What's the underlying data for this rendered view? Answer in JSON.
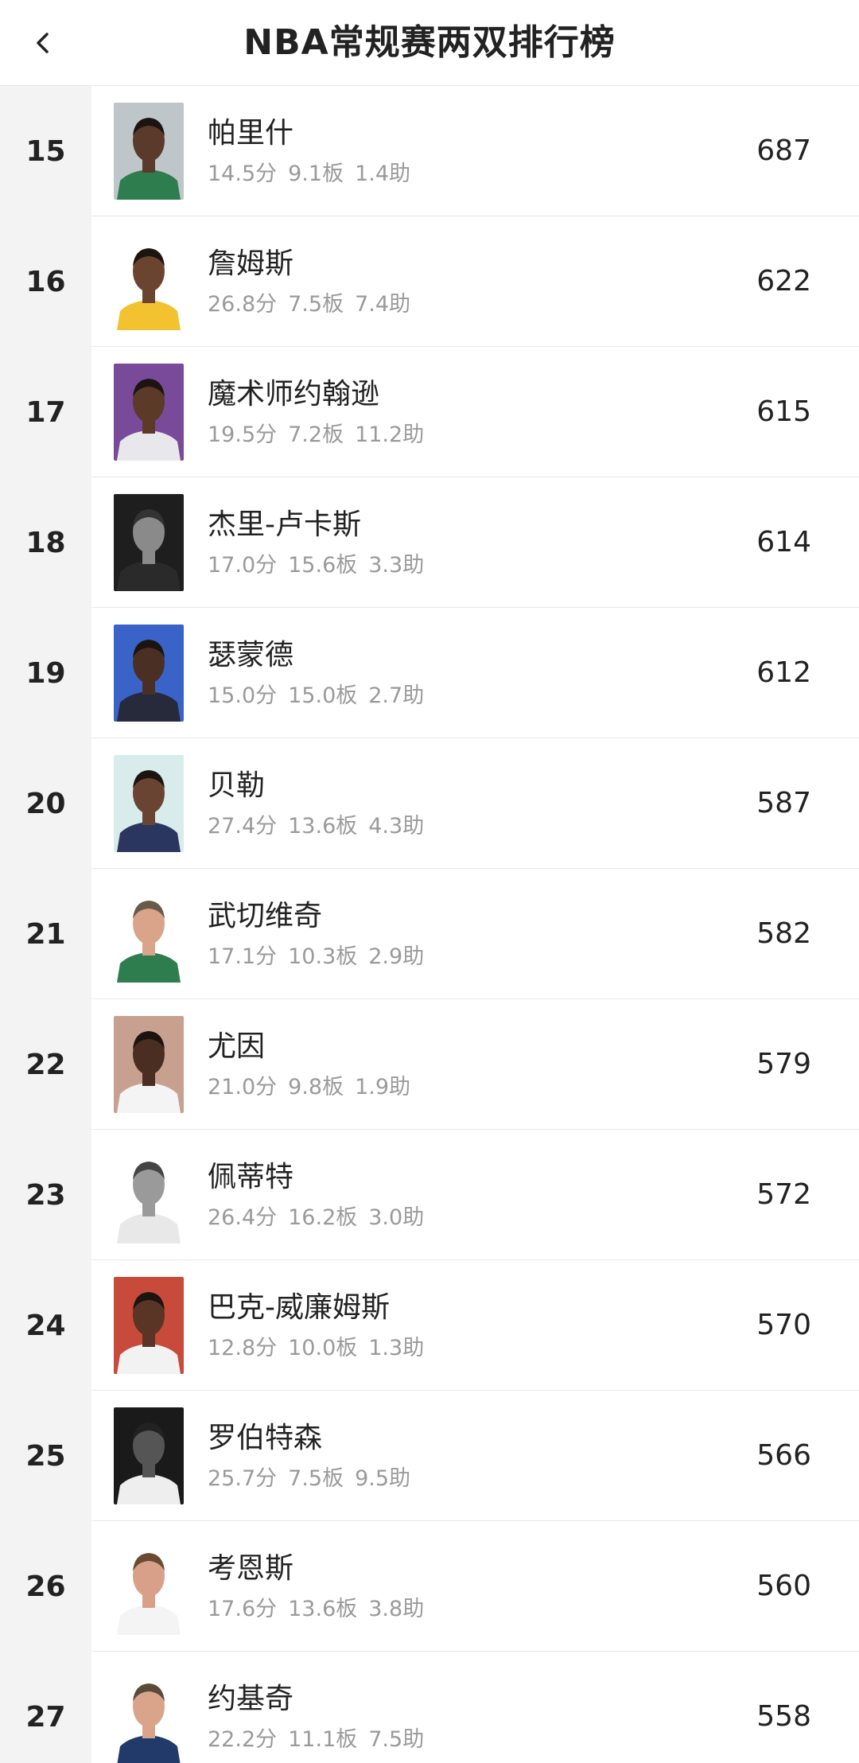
{
  "header": {
    "title": "NBA常规赛两双排行榜",
    "back_icon": "chevron-left-icon"
  },
  "rows": [
    {
      "rank": "15",
      "name": "帕里什",
      "pts": "14.5分",
      "reb": "9.1板",
      "ast": "1.4助",
      "value": "687",
      "skin": "#5a3a2a",
      "jersey": "#2e7d4f",
      "bg": "#bfc6c9",
      "hair": "#1c1410"
    },
    {
      "rank": "16",
      "name": "詹姆斯",
      "pts": "26.8分",
      "reb": "7.5板",
      "ast": "7.4助",
      "value": "622",
      "skin": "#6b4430",
      "jersey": "#f2c230",
      "bg": "#ffffff",
      "hair": "#1c1410"
    },
    {
      "rank": "17",
      "name": "魔术师约翰逊",
      "pts": "19.5分",
      "reb": "7.2板",
      "ast": "11.2助",
      "value": "615",
      "skin": "#5b3a28",
      "jersey": "#e8e8ec",
      "bg": "#7a4a9a",
      "hair": "#1c1410"
    },
    {
      "rank": "18",
      "name": "杰里-卢卡斯",
      "pts": "17.0分",
      "reb": "15.6板",
      "ast": "3.3助",
      "value": "614",
      "skin": "#8a8a8a",
      "jersey": "#2a2a2a",
      "bg": "#1e1e1e",
      "hair": "#333333"
    },
    {
      "rank": "19",
      "name": "瑟蒙德",
      "pts": "15.0分",
      "reb": "15.0板",
      "ast": "2.7助",
      "value": "612",
      "skin": "#4a3024",
      "jersey": "#262a3a",
      "bg": "#3a63c8",
      "hair": "#1c1410"
    },
    {
      "rank": "20",
      "name": "贝勒",
      "pts": "27.4分",
      "reb": "13.6板",
      "ast": "4.3助",
      "value": "587",
      "skin": "#6a4432",
      "jersey": "#2a3560",
      "bg": "#d8ecec",
      "hair": "#1c1410"
    },
    {
      "rank": "21",
      "name": "武切维奇",
      "pts": "17.1分",
      "reb": "10.3板",
      "ast": "2.9助",
      "value": "582",
      "skin": "#d9a48a",
      "jersey": "#2e7d4f",
      "bg": "#ffffff",
      "hair": "#6b5a4a"
    },
    {
      "rank": "22",
      "name": "尤因",
      "pts": "21.0分",
      "reb": "9.8板",
      "ast": "1.9助",
      "value": "579",
      "skin": "#4a2e22",
      "jersey": "#f4f4f4",
      "bg": "#c8a090",
      "hair": "#1c1410"
    },
    {
      "rank": "23",
      "name": "佩蒂特",
      "pts": "26.4分",
      "reb": "16.2板",
      "ast": "3.0助",
      "value": "572",
      "skin": "#9a9a9a",
      "jersey": "#e8e8e8",
      "bg": "#ffffff",
      "hair": "#444444"
    },
    {
      "rank": "24",
      "name": "巴克-威廉姆斯",
      "pts": "12.8分",
      "reb": "10.0板",
      "ast": "1.3助",
      "value": "570",
      "skin": "#5a3424",
      "jersey": "#f2f2f2",
      "bg": "#c84a3a",
      "hair": "#1c1410"
    },
    {
      "rank": "25",
      "name": "罗伯特森",
      "pts": "25.7分",
      "reb": "7.5板",
      "ast": "9.5助",
      "value": "566",
      "skin": "#555555",
      "jersey": "#eeeeee",
      "bg": "#1a1a1a",
      "hair": "#222222"
    },
    {
      "rank": "26",
      "name": "考恩斯",
      "pts": "17.6分",
      "reb": "13.6板",
      "ast": "3.8助",
      "value": "560",
      "skin": "#d8a088",
      "jersey": "#f4f4f4",
      "bg": "#ffffff",
      "hair": "#6a4a30"
    },
    {
      "rank": "27",
      "name": "约基奇",
      "pts": "22.2分",
      "reb": "11.1板",
      "ast": "7.5助",
      "value": "558",
      "skin": "#d9a48a",
      "jersey": "#223a6a",
      "bg": "#ffffff",
      "hair": "#5a4a3a"
    }
  ]
}
